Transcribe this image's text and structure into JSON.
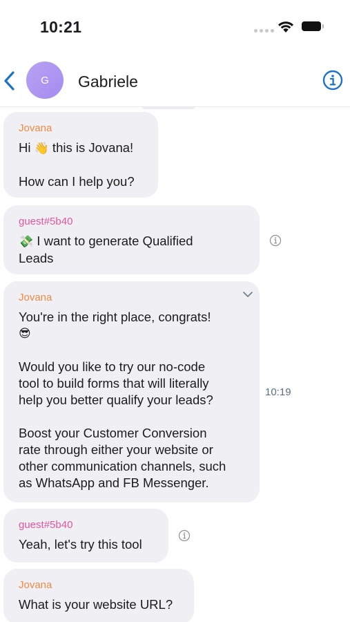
{
  "status_bar": {
    "time": "10:21"
  },
  "header": {
    "back_icon": "chevron-left-icon",
    "avatar_initial": "G",
    "contact_name": "Gabriele",
    "info_icon": "info-circle-icon",
    "accent_color": "#1a73c8"
  },
  "messages": [
    {
      "sender": "Jovana",
      "role": "agent",
      "line1_pre": "Hi ",
      "line1_emoji": "👋",
      "line1_post": " this is Jovana!",
      "line2": "How can I help you?"
    },
    {
      "sender": "guest#5b40",
      "role": "guest",
      "line1_emoji": "💸",
      "line1_post": " I want to generate Qualified",
      "line2": "Leads"
    },
    {
      "sender": "Jovana",
      "role": "agent",
      "lines": [
        "You're in the right place, congrats!",
        "😎",
        "",
        "Would you like to try our no-code",
        "tool to build forms that will literally",
        "help you better qualify your leads?",
        "",
        "Boost your Customer Conversion",
        "rate through either your website or",
        "other communication channels, such",
        "as WhatsApp and FB Messenger."
      ],
      "time": "10:19"
    },
    {
      "sender": "guest#5b40",
      "role": "guest",
      "line1": "Yeah, let's try this tool"
    },
    {
      "sender": "Jovana",
      "role": "agent",
      "line1": "What is your website URL?"
    }
  ],
  "colors": {
    "agent_name": "#f08a45",
    "guest_name": "#e2569f",
    "bubble": "#efeff4",
    "avatar": "#ab92f0"
  }
}
